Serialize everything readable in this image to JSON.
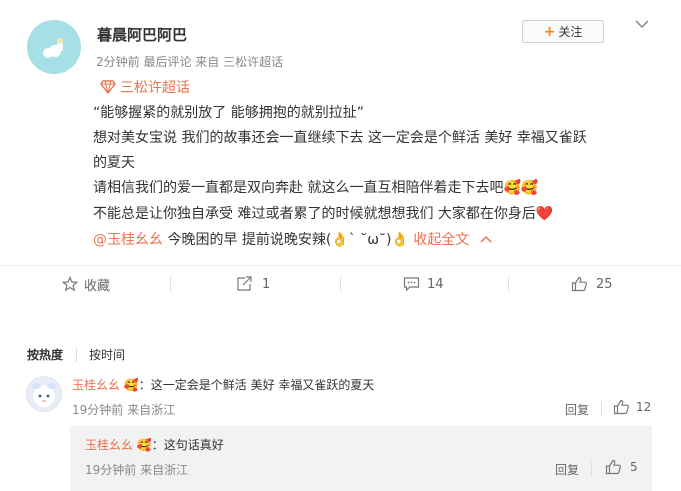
{
  "post": {
    "username": "暮晨阿巴阿巴",
    "meta": "2分钟前 最后评论 来自 三松许超话",
    "follow_label": "关注",
    "topic": "三松许超话",
    "lines": [
      "“能够握紧的就别放了 能够拥抱的就别拉扯”",
      "想对美女宝说 我们的故事还会一直继续下去 这一定会是个鲜活 美好 幸福又雀跃",
      "的夏天",
      "请相信我们的爱一直都是双向奔赴 就这么一直互相陪伴着走下去吧🥰🥰",
      "不能总是让你独自承受 难过或者累了的时候就想想我们 大家都在你身后❤️"
    ],
    "last_line": {
      "mention": "@玉桂幺幺",
      "text": " 今晚困的早 提前说晚安辣(👌ˋ ˘ω˘)👌",
      "collapse_label": "收起全文"
    }
  },
  "toolbar": {
    "favorite_label": "收藏",
    "share_count": "1",
    "comment_count": "14",
    "like_count": "25"
  },
  "comments": {
    "sort_hot": "按热度",
    "sort_time": "按时间",
    "items": [
      {
        "name": "玉桂幺幺",
        "badge": "🥰",
        "text": "：这一定会是个鲜活 美好 幸福又雀跃的夏天",
        "meta": "19分钟前 来自浙江",
        "reply_label": "回复",
        "likes": "12"
      }
    ],
    "replies": [
      {
        "name": "玉桂幺幺",
        "badge": "🥰",
        "text": "：这句话真好",
        "meta": "19分钟前 来自浙江",
        "reply_label": "回复",
        "likes": "5"
      }
    ]
  },
  "colors": {
    "accent": "#eb7350",
    "follow_plus": "#ff8200",
    "avatar_bg": "#a6dfe6"
  }
}
